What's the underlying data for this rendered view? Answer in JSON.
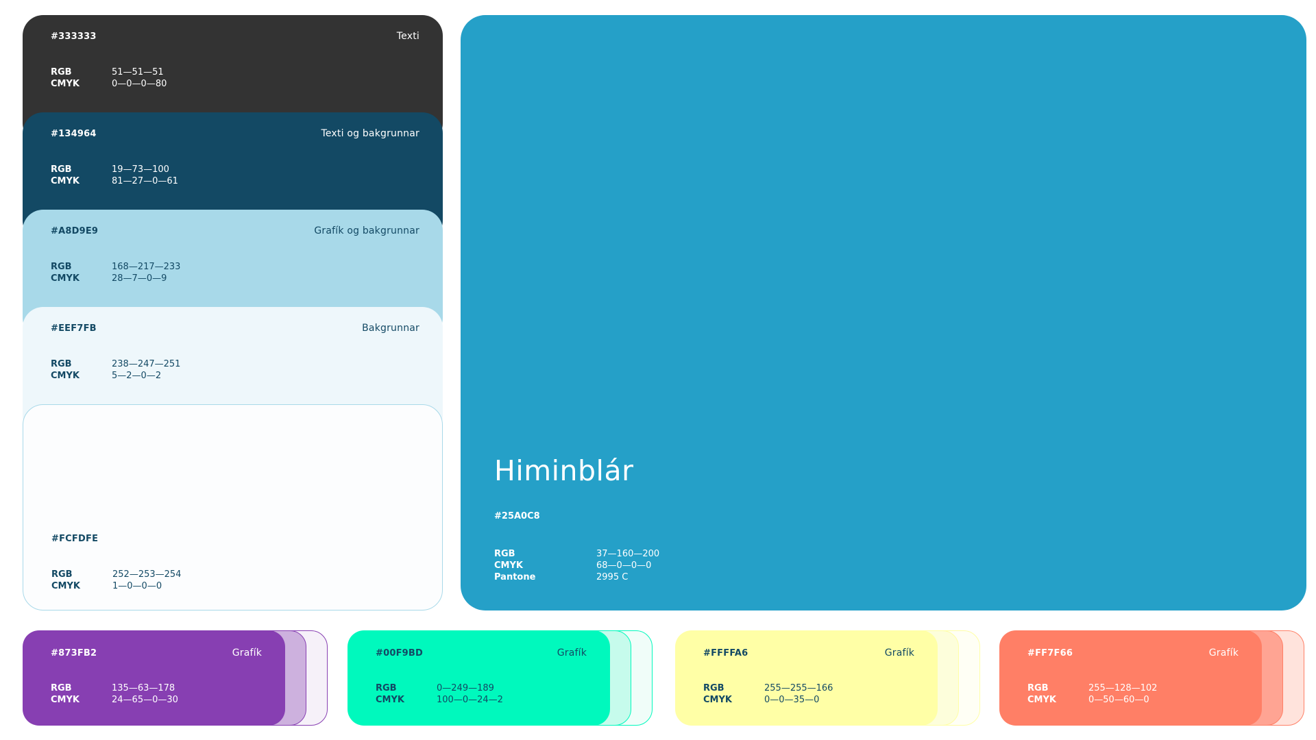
{
  "stack": [
    {
      "hex": "#333333",
      "role": "Texti",
      "rgb": "51—51—51",
      "cmyk": "0—0—0—80",
      "color": "#333333"
    },
    {
      "hex": "#134964",
      "role": "Texti og bakgrunnar",
      "rgb": "19—73—100",
      "cmyk": "81—27—0—61",
      "color": "#134964"
    },
    {
      "hex": "#A8D9E9",
      "role": "Grafík og bakgrunnar",
      "rgb": "168—217—233",
      "cmyk": "28—7—0—9",
      "color": "#A8D9E9"
    },
    {
      "hex": "#EEF7FB",
      "role": "Bakgrunnar",
      "rgb": "238—247—251",
      "cmyk": "5—2—0—2",
      "color": "#EEF7FB"
    },
    {
      "hex": "#FCFDFE",
      "role": "",
      "rgb": "252—253—254",
      "cmyk": "1—0—0—0",
      "color": "#FCFDFE"
    }
  ],
  "labels": {
    "rgb": "RGB",
    "cmyk": "CMYK",
    "pantone": "Pantone"
  },
  "hero": {
    "name": "Himinblár",
    "hex": "#25A0C8",
    "rgb": "37—160—200",
    "cmyk": "68—0—0—0",
    "pantone": "2995 C",
    "color": "#25A0C8"
  },
  "minis": [
    {
      "hex": "#873FB2",
      "role": "Grafík",
      "rgb": "135—63—178",
      "cmyk": "24—65—0—30",
      "color": "#873FB2"
    },
    {
      "hex": "#00F9BD",
      "role": "Grafík",
      "rgb": "0—249—189",
      "cmyk": "100—0—24—2",
      "color": "#00F9BD"
    },
    {
      "hex": "#FFFFA6",
      "role": "Grafík",
      "rgb": "255—255—166",
      "cmyk": "0—0—35—0",
      "color": "#FFFFA6"
    },
    {
      "hex": "#FF7F66",
      "role": "Grafík",
      "rgb": "255—128—102",
      "cmyk": "0—50—60—0",
      "color": "#FF7F66"
    }
  ]
}
